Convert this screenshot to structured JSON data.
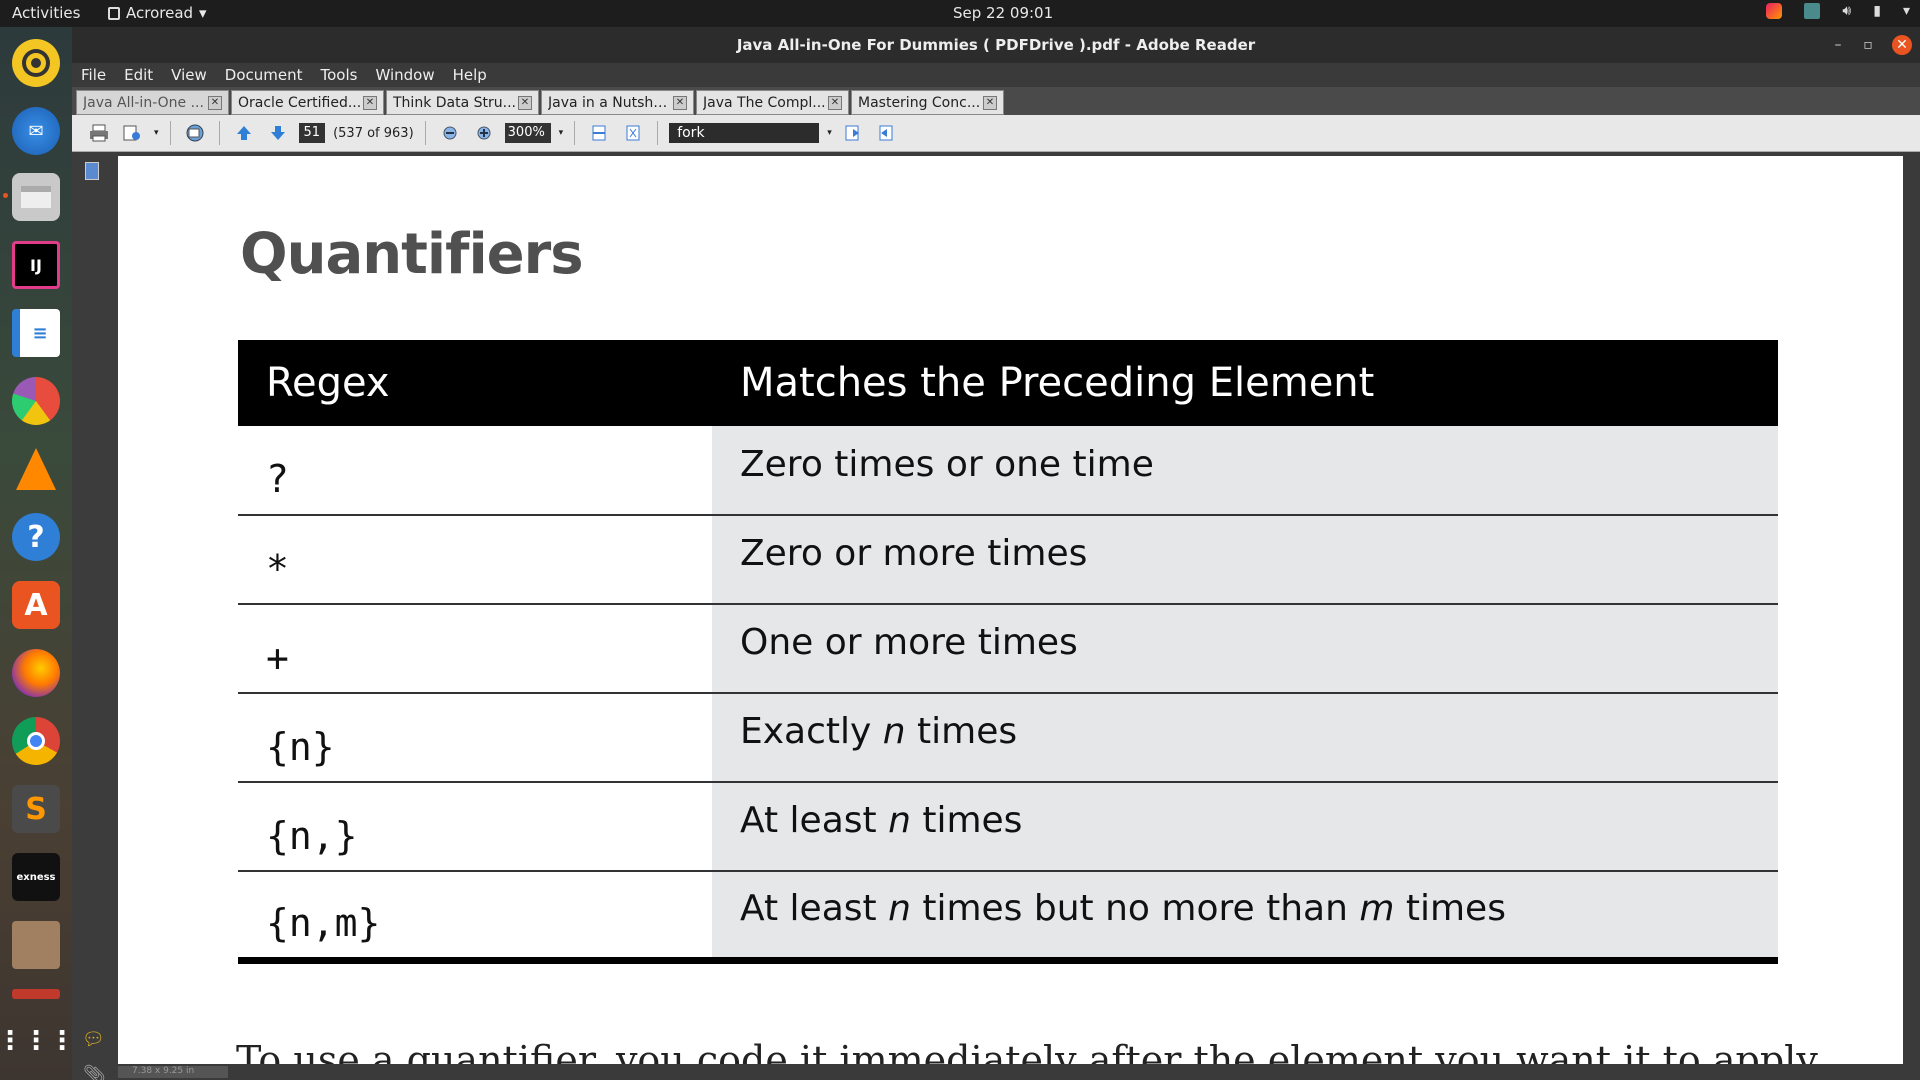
{
  "topbar": {
    "activities": "Activities",
    "app_menu": "Acroread",
    "clock": "Sep 22  09:01"
  },
  "window": {
    "title": "Java All-in-One For Dummies ( PDFDrive ).pdf - Adobe Reader"
  },
  "menubar": [
    "File",
    "Edit",
    "View",
    "Document",
    "Tools",
    "Window",
    "Help"
  ],
  "tabs": [
    {
      "label": "Java All-in-One ...",
      "active": true
    },
    {
      "label": "Oracle Certified...",
      "active": false
    },
    {
      "label": "Think Data Stru...",
      "active": false
    },
    {
      "label": "Java in a Nutshe...",
      "active": false
    },
    {
      "label": "Java The Compl...",
      "active": false
    },
    {
      "label": "Mastering Conc...",
      "active": false
    }
  ],
  "toolbar": {
    "page_number": "51",
    "page_count": "(537 of 963)",
    "zoom": "300%",
    "search_value": "fork"
  },
  "document": {
    "heading": "Quantifiers",
    "table": {
      "headers": [
        "Regex",
        "Matches the Preceding Element"
      ],
      "rows": [
        {
          "regex": "?",
          "desc": "Zero times or one time"
        },
        {
          "regex": "*",
          "desc": "Zero or more times"
        },
        {
          "regex": "+",
          "desc": "One or more times"
        },
        {
          "regex": "{n}",
          "desc_parts": [
            "Exactly ",
            "n",
            " times"
          ]
        },
        {
          "regex": "{n,}",
          "desc_parts": [
            "At least ",
            "n",
            " times"
          ]
        },
        {
          "regex": "{n,m}",
          "desc_parts": [
            "At least ",
            "n",
            " times but no more than ",
            "m",
            " times"
          ]
        }
      ]
    },
    "body_text": "To use a quantifier, you code it immediately after the element you want it to apply"
  },
  "status": {
    "page_size": "7.38 x 9.25 in"
  },
  "colors": {
    "accent": "#e95420",
    "table_header_bg": "#000000",
    "desc_cell_bg": "#e6e7e9"
  }
}
